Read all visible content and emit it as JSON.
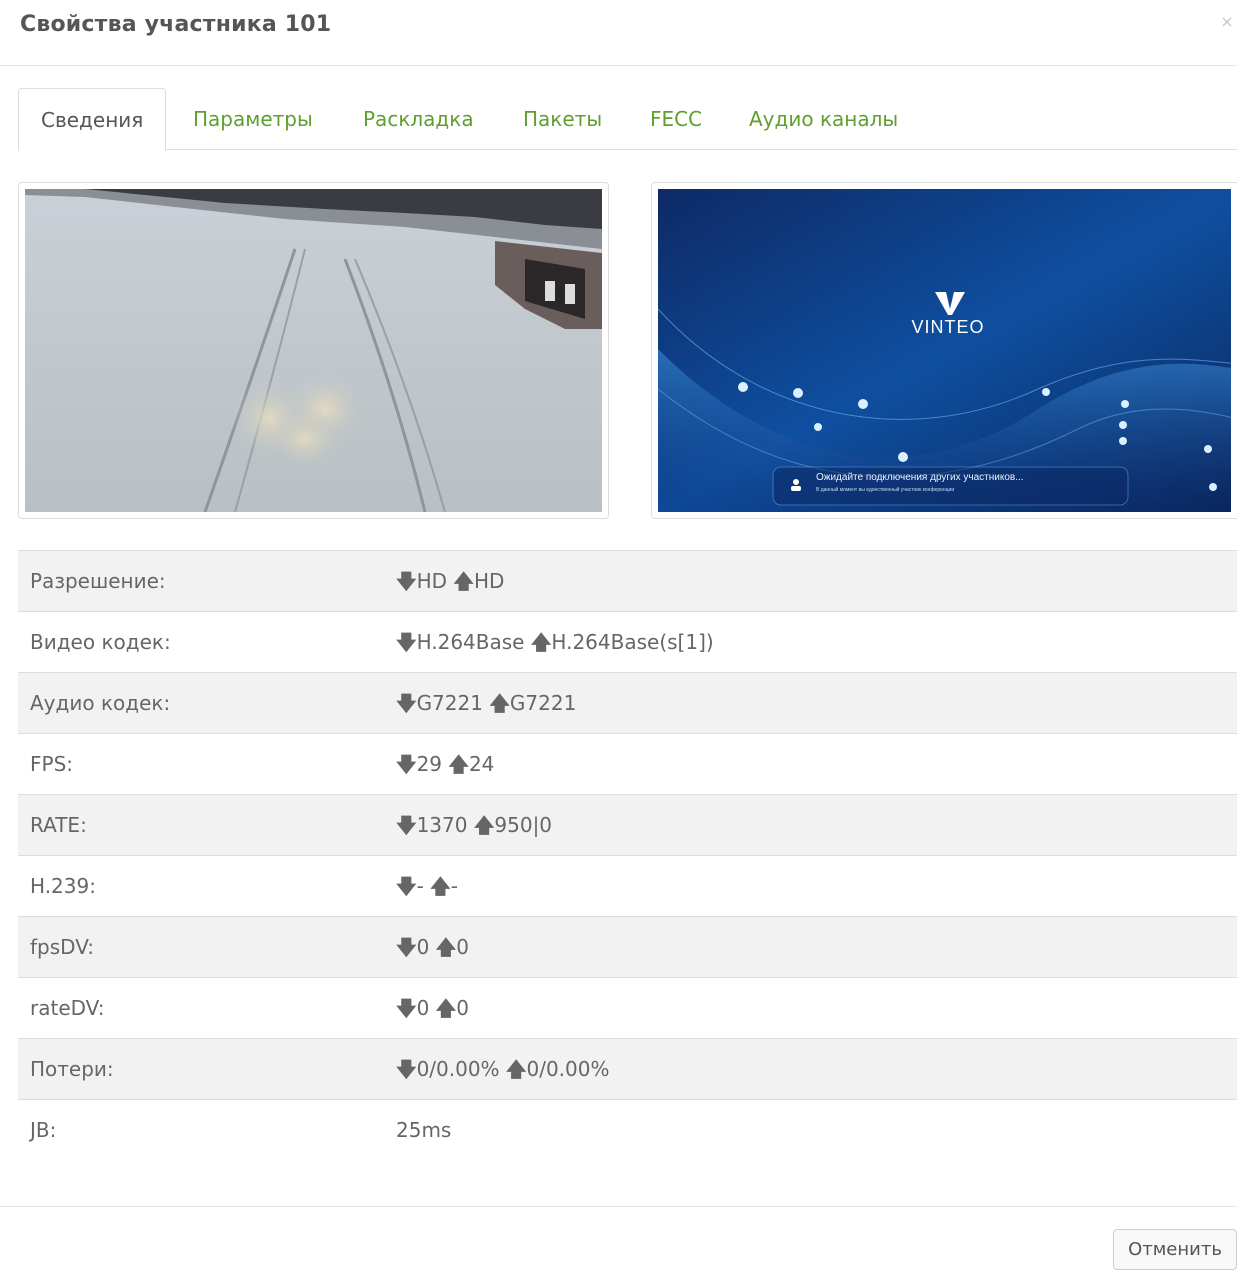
{
  "dialog": {
    "title": "Свойства участника 101",
    "close_label": "×",
    "cancel_label": "Отменить"
  },
  "tabs": [
    {
      "label": "Сведения",
      "active": true
    },
    {
      "label": "Параметры",
      "active": false
    },
    {
      "label": "Раскладка",
      "active": false
    },
    {
      "label": "Пакеты",
      "active": false
    },
    {
      "label": "FECC",
      "active": false
    },
    {
      "label": "Аудио каналы",
      "active": false
    }
  ],
  "previews": {
    "right": {
      "logo_text": "VINTEO",
      "waiting_text": "Ожидайте подключения других участников...",
      "waiting_subtext": "В данный момент вы единственный участник конференции"
    }
  },
  "stats": [
    {
      "label": "Разрешение:",
      "down": "HD",
      "up": "HD"
    },
    {
      "label": "Видео кодек:",
      "down": "H.264Base",
      "up": "H.264Base(s[1])"
    },
    {
      "label": "Аудио кодек:",
      "down": "G7221",
      "up": "G7221"
    },
    {
      "label": "FPS:",
      "down": "29",
      "up": "24"
    },
    {
      "label": "RATE:",
      "down": "1370",
      "up": "950|0"
    },
    {
      "label": "H.239:",
      "down": "-",
      "up": "-"
    },
    {
      "label": "fpsDV:",
      "down": "0",
      "up": "0"
    },
    {
      "label": "rateDV:",
      "down": "0",
      "up": "0"
    },
    {
      "label": "Потери:",
      "down": "0/0.00%",
      "up": "0/0.00%"
    },
    {
      "label": "JB:",
      "value": "25ms"
    }
  ],
  "colors": {
    "accent_green": "#5e9f2e",
    "row_stripe": "#f2f2f2"
  }
}
